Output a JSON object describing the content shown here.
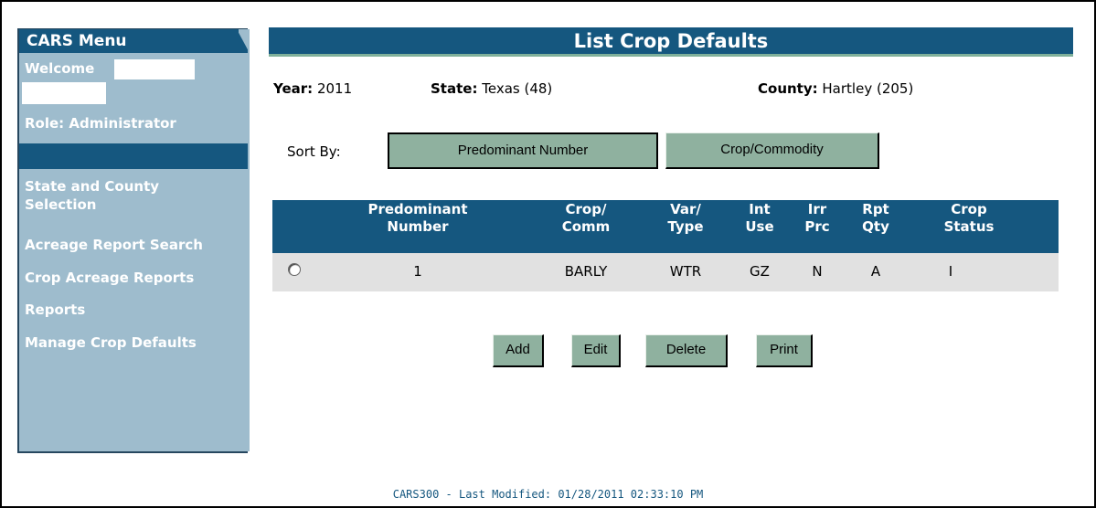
{
  "sidebar": {
    "title": "CARS Menu",
    "welcome_label": "Welcome",
    "role_label": "Role: Administrator",
    "links": [
      "State and County\nSelection",
      "Acreage Report Search",
      "Crop Acreage Reports",
      "Reports",
      "Manage Crop Defaults"
    ]
  },
  "page": {
    "title": "List Crop Defaults",
    "year_label": "Year:",
    "year_value": "2011",
    "state_label": "State:",
    "state_value": "Texas (48)",
    "county_label": "County:",
    "county_value": "Hartley (205)"
  },
  "sort": {
    "label": "Sort By:",
    "options": [
      "Predominant Number",
      "Crop/Commodity"
    ],
    "selected": "Predominant Number"
  },
  "table": {
    "headers": [
      [
        "Predominant",
        "Number"
      ],
      [
        "Crop/",
        "Comm"
      ],
      [
        "Var/",
        "Type"
      ],
      [
        "Int",
        "Use"
      ],
      [
        "Irr",
        "Prc"
      ],
      [
        "Rpt",
        "Qty"
      ],
      [
        "Crop",
        "Status"
      ]
    ],
    "rows": [
      [
        "1",
        "BARLY",
        "WTR",
        "GZ",
        "N",
        "A",
        "I"
      ]
    ]
  },
  "actions": [
    "Add",
    "Edit",
    "Delete",
    "Print"
  ],
  "footer": "CARS300 -  Last Modified: 01/28/2011 02:33:10 PM",
  "colors": {
    "header_blue": "#15577f",
    "sidebar_bg": "#9ebccd",
    "button_bg": "#8fb19f",
    "row_bg": "#e1e1e1"
  }
}
